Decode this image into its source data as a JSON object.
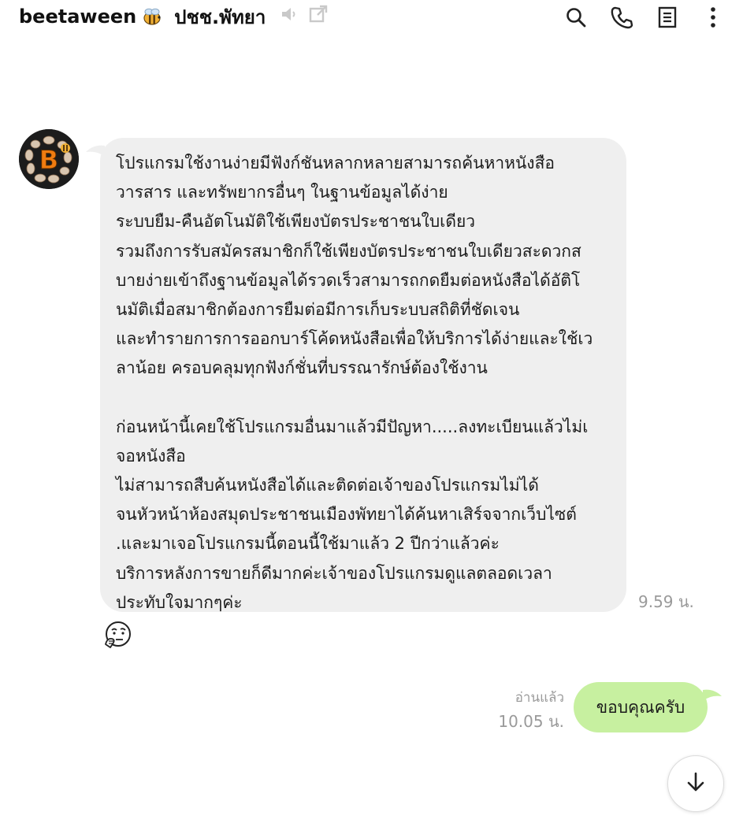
{
  "header": {
    "title_part1": "beetaween",
    "title_part2": "ปชช.พัทยา",
    "bee_icon": "bee-emoji-icon",
    "mute_icon": "speaker-muted-icon",
    "popout_icon": "open-external-icon",
    "actions": [
      {
        "name": "search",
        "icon": "search-icon"
      },
      {
        "name": "call",
        "icon": "phone-icon"
      },
      {
        "name": "notes",
        "icon": "notes-icon"
      },
      {
        "name": "more",
        "icon": "more-vertical-icon"
      }
    ]
  },
  "incoming": {
    "avatar_letter": "B",
    "paragraph1": "โปรแกรมใช้งานง่ายมีฟังก์ชันหลากหลายสามารถค้นหาหนังสือ\nวารสาร และทรัพยากรอื่นๆ ในฐานข้อมูลได้ง่าย\nระบบยืม-คืนอัตโนมัติใช้เพียงบัตรประชาชนใบเดียว\nรวมถึงการรับสมัครสมาชิกก็ใช้เพียงบัตรประชาชนใบเดียวสะดวกส\nบายง่ายเข้าถึงฐานข้อมูลได้รวดเร็วสามารถกดยืมต่อหนังสือได้อัติโ\nนมัติเมื่อสมาชิกต้องการยืมต่อมีการเก็บระบบสถิติที่ชัดเจน\nและทำรายการการออกบาร์โค้ดหนังสือเพื่อให้บริการได้ง่ายและใช้เว\nลาน้อย ครอบคลุมทุกฟังก์ชั่นที่บรรณารักษ์ต้องใช้งาน",
    "paragraph2": "ก่อนหน้านี้เคยใช้โปรแกรมอื่นมาแล้วมีปัญหา.....ลงทะเบียนแล้วไม่เ\nจอหนังสือ\nไม่สามารถสืบค้นหนังสือได้และติดต่อเจ้าของโปรแกรมไม่ได้\nจนหัวหน้าห้องสมุดประชาชนเมืองพัทยาได้ค้นหาเสิร์จจากเว็บไซต์\n.และมาเจอโปรแกรมนี้ตอนนี้ใช้มาแล้ว 2 ปีกว่าแล้วค่ะ\nบริการหลังการขายก็ดีมากค่ะเจ้าของโปรแกรมดูแลตลอดเวลา\nประทับใจมากๆค่ะ",
    "time": "9.59 น.",
    "reaction_icon": "thinking-face-emoji-icon"
  },
  "outgoing": {
    "read_status": "อ่านแล้ว",
    "time": "10.05 น.",
    "text": "ขอบคุณครับ"
  },
  "scroll_button_icon": "arrow-down-icon",
  "colors": {
    "incoming_bubble": "#efefef",
    "outgoing_bubble": "#c7f0a0",
    "meta_text": "#9a9a9a"
  }
}
